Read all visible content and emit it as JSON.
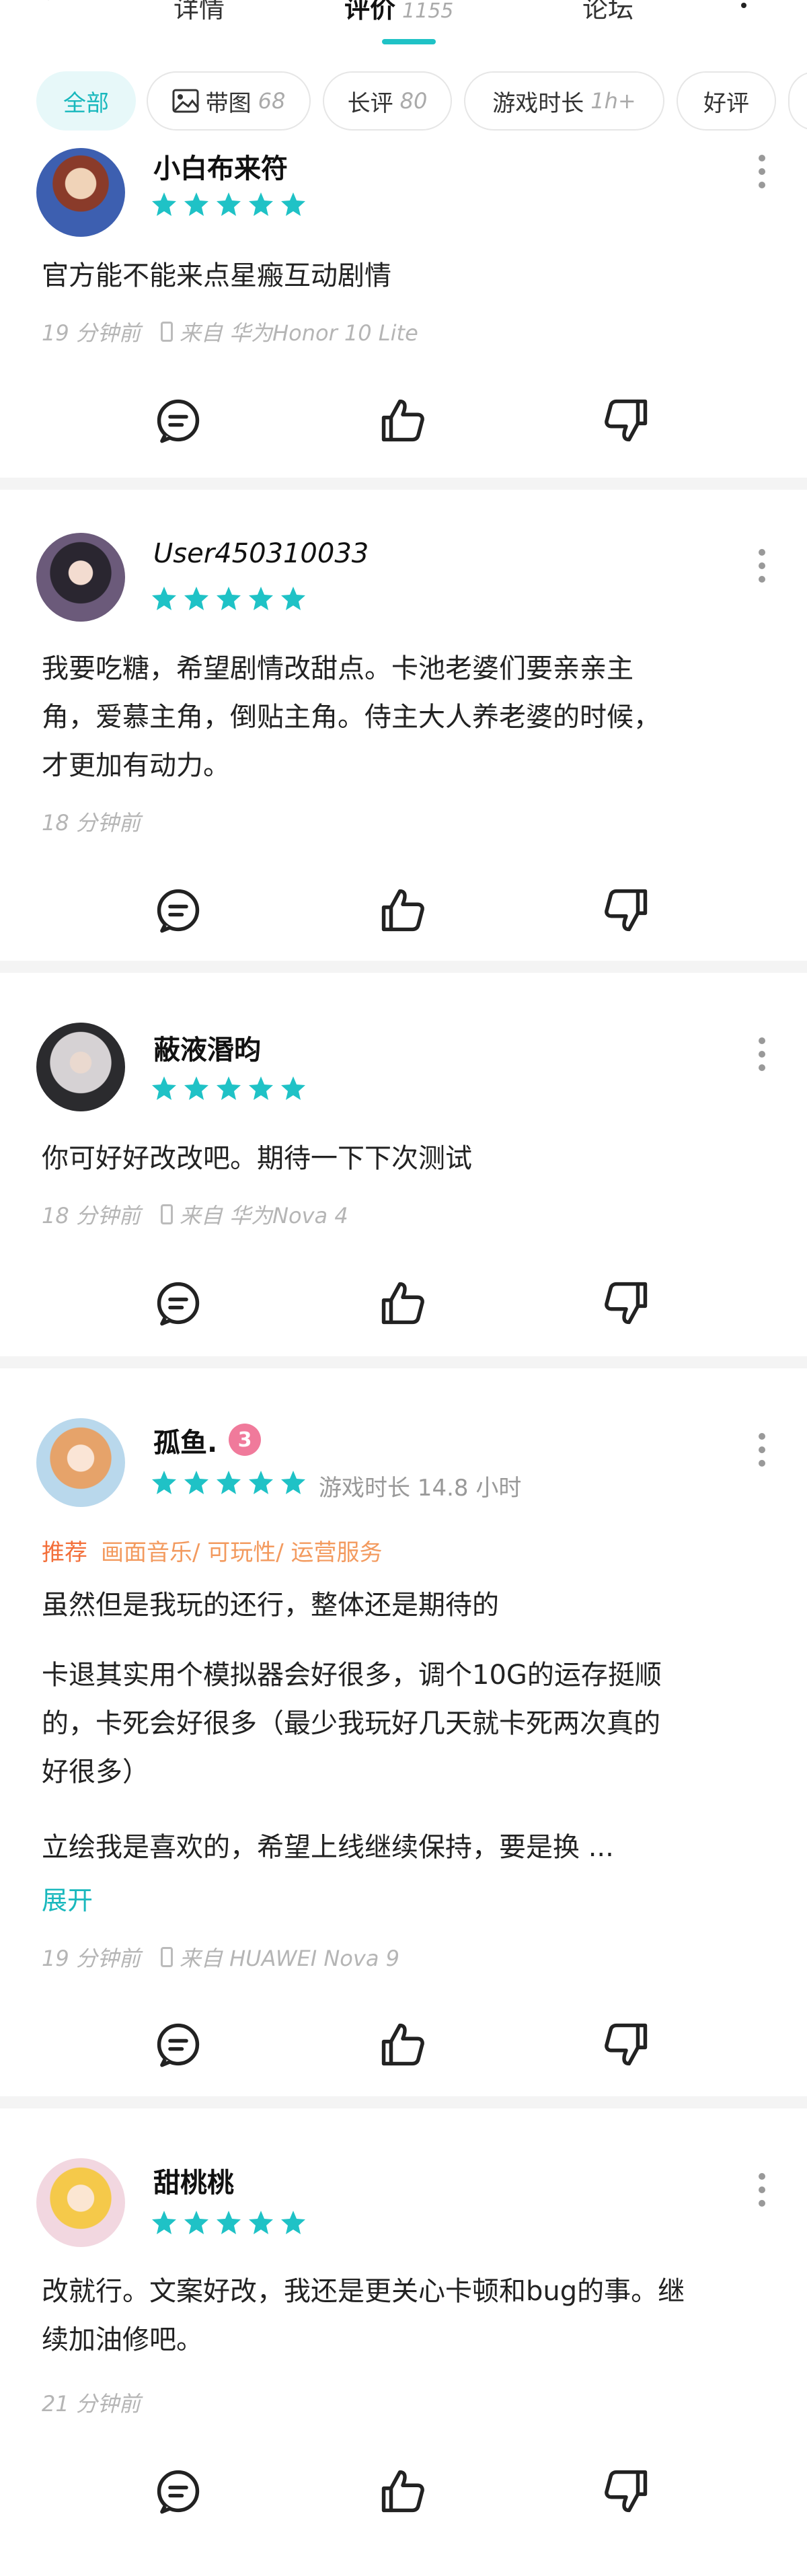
{
  "header": {
    "tabs": [
      {
        "label": "详情",
        "count": ""
      },
      {
        "label": "评价",
        "count": "1155"
      },
      {
        "label": "论坛",
        "count": ""
      }
    ]
  },
  "filters": [
    {
      "label": "全部",
      "count": "",
      "active": true,
      "icon": ""
    },
    {
      "label": "带图",
      "count": "68",
      "active": false,
      "icon": "image-icon"
    },
    {
      "label": "长评",
      "count": "80",
      "active": false,
      "icon": ""
    },
    {
      "label": "游戏时长",
      "count": "1h+",
      "active": false,
      "icon": ""
    },
    {
      "label": "好评",
      "count": "",
      "active": false,
      "icon": ""
    }
  ],
  "accent_color": "#1fc2c6",
  "star_color": "#1fc2c6",
  "reviews": [
    {
      "user": "小白布来符",
      "stars": 5,
      "text": "官方能不能来点星瘢互动剧情",
      "time": "19 分钟前",
      "device": "来自 华为Honor 10 Lite"
    },
    {
      "user": "User450310033",
      "stars": 5,
      "text": "我要吃糖，希望剧情改甜点。卡池老婆们要亲亲主\n角，爱慕主角，倒贴主角。侍主大人养老婆的时候，\n才更加有动力。",
      "time": "18 分钟前",
      "device": ""
    },
    {
      "user": "蔽液湣昀",
      "stars": 5,
      "text": "你可好好改改吧。期待一下下次测试",
      "time": "18 分钟前",
      "device": "来自 华为Nova 4"
    },
    {
      "user": "孤鱼.",
      "badge": "3",
      "stars": 5,
      "playtime": "游戏时长 14.8 小时",
      "recommend_label": "推荐",
      "recommend_tags": "画面音乐/ 可玩性/ 运营服务",
      "paragraphs": [
        "虽然但是我玩的还行，整体还是期待的",
        "卡退其实用个模拟器会好很多，调个10G的运存挺顺\n的，卡死会好很多（最少我玩好几天就卡死两次真的\n好很多）",
        "立绘我是喜欢的，希望上线继续保持，要是换 ..."
      ],
      "expand_label": "展开",
      "time": "19 分钟前",
      "device": "来自 HUAWEI Nova 9"
    },
    {
      "user": "甜桃桃",
      "stars": 5,
      "text": "改就行。文案好改，我还是更关心卡顿和bug的事。继\n续加油修吧。",
      "time": "21 分钟前",
      "device": ""
    }
  ]
}
